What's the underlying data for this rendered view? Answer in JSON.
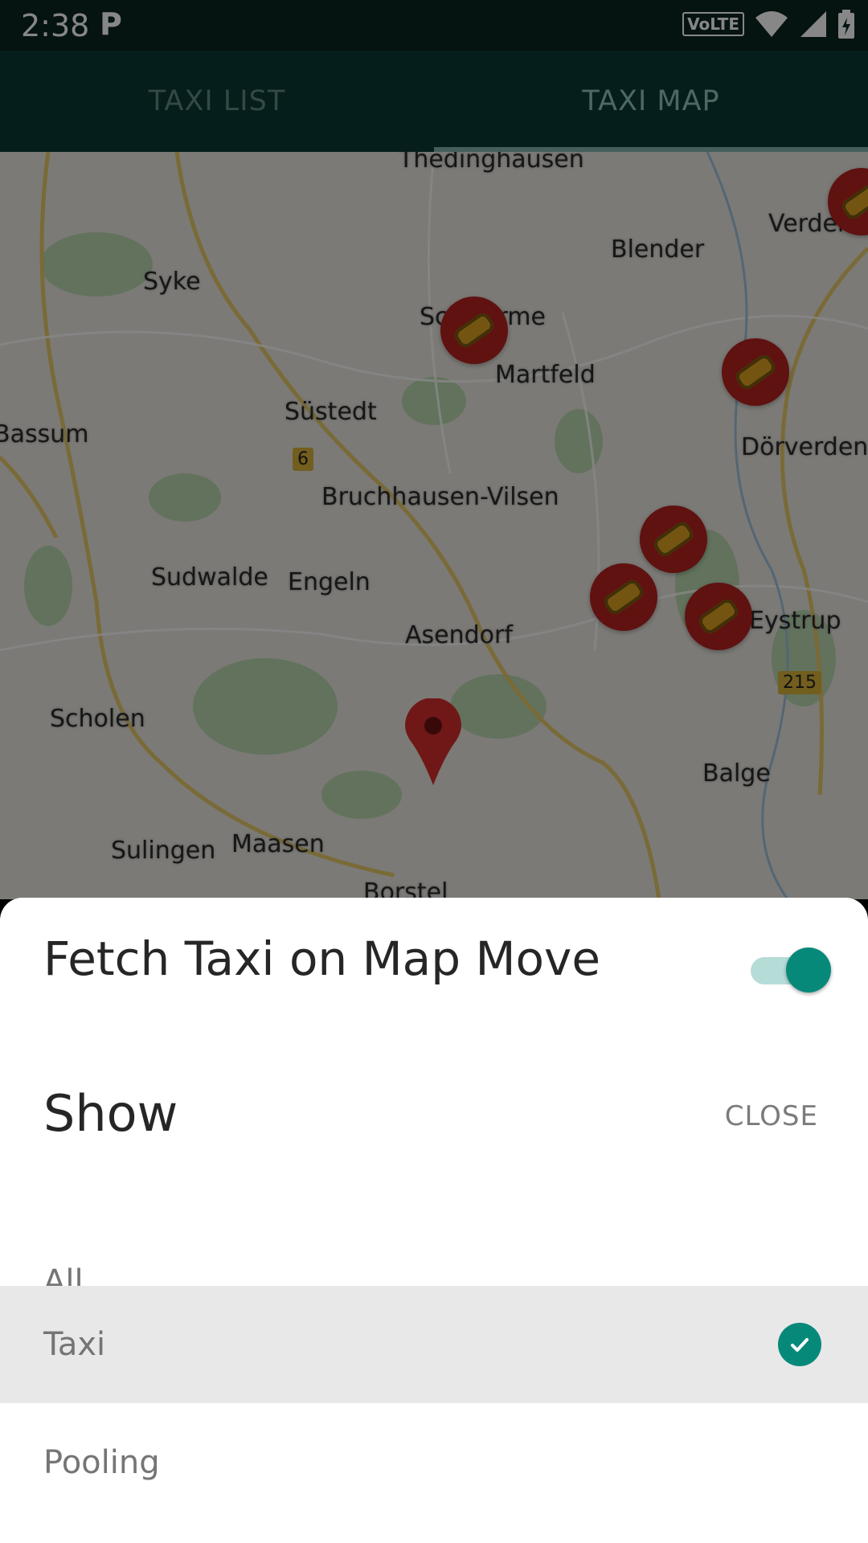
{
  "status_bar": {
    "time": "2:38",
    "app_icon": "P",
    "network": "VoLTE"
  },
  "tabs": [
    {
      "label": "TAXI LIST",
      "active": false
    },
    {
      "label": "TAXI MAP",
      "active": true
    }
  ],
  "map": {
    "place_labels": [
      "Thedinghausen",
      "Blender",
      "Verden",
      "Syke",
      "Martfeld",
      "Süstedt",
      "Bassum",
      "Dörverden",
      "Bruchhausen-Vilsen",
      "Sudwalde",
      "Engeln",
      "Asendorf",
      "Eystrup",
      "Scholen",
      "Balge",
      "Sulingen",
      "Maasen",
      "Borstel",
      "Schwarme"
    ],
    "road_badges": [
      "6",
      "215"
    ],
    "marker_icon": "taxi-car-icon",
    "pin_icon": "location-pin-icon"
  },
  "sheet": {
    "fetch_toggle_label": "Fetch Taxi on Map Move",
    "fetch_toggle_on": true,
    "show_title": "Show",
    "close_label": "CLOSE",
    "options": [
      {
        "label": "All",
        "selected": false
      },
      {
        "label": "Taxi",
        "selected": true
      },
      {
        "label": "Pooling",
        "selected": false
      }
    ],
    "accent_color": "#07897a"
  }
}
